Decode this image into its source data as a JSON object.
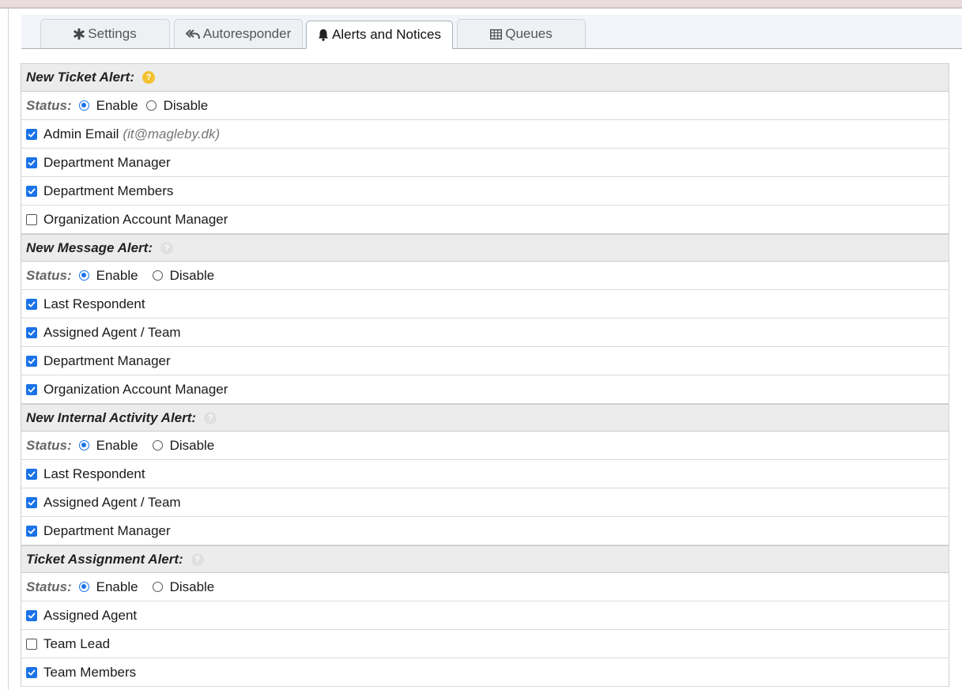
{
  "tabs": [
    {
      "label": "Settings",
      "icon": "asterisk-icon",
      "active": false
    },
    {
      "label": "Autoresponder",
      "icon": "reply-all-icon",
      "active": false
    },
    {
      "label": "Alerts and Notices",
      "icon": "bell-icon",
      "active": true
    },
    {
      "label": "Queues",
      "icon": "table-icon",
      "active": false
    }
  ],
  "colors": {
    "accent": "#1a73e8",
    "help_active": "#f3c230",
    "header_bg": "#ececec"
  },
  "sections": [
    {
      "title": "New Ticket Alert:",
      "status_label": "Status:",
      "enable_label": "Enable",
      "disable_label": "Disable",
      "enabled": true,
      "items": [
        {
          "label": "Admin Email",
          "note": "(it@magleby.dk)",
          "checked": true
        },
        {
          "label": "Department Manager",
          "checked": true
        },
        {
          "label": "Department Members",
          "checked": true
        },
        {
          "label": "Organization Account Manager",
          "checked": false
        }
      ]
    },
    {
      "title": "New Message Alert:",
      "status_label": "Status:",
      "enable_label": "Enable",
      "disable_label": "Disable",
      "enabled": true,
      "items": [
        {
          "label": "Last Respondent",
          "checked": true
        },
        {
          "label": "Assigned Agent / Team",
          "checked": true
        },
        {
          "label": "Department Manager",
          "checked": true
        },
        {
          "label": "Organization Account Manager",
          "checked": true
        }
      ]
    },
    {
      "title": "New Internal Activity Alert:",
      "status_label": "Status:",
      "enable_label": "Enable",
      "disable_label": "Disable",
      "enabled": true,
      "items": [
        {
          "label": "Last Respondent",
          "checked": true
        },
        {
          "label": "Assigned Agent / Team",
          "checked": true
        },
        {
          "label": "Department Manager",
          "checked": true
        }
      ]
    },
    {
      "title": "Ticket Assignment Alert:",
      "status_label": "Status:",
      "enable_label": "Enable",
      "disable_label": "Disable",
      "enabled": true,
      "items": [
        {
          "label": "Assigned Agent",
          "checked": true
        },
        {
          "label": "Team Lead",
          "checked": false
        },
        {
          "label": "Team Members",
          "checked": true
        }
      ]
    }
  ]
}
